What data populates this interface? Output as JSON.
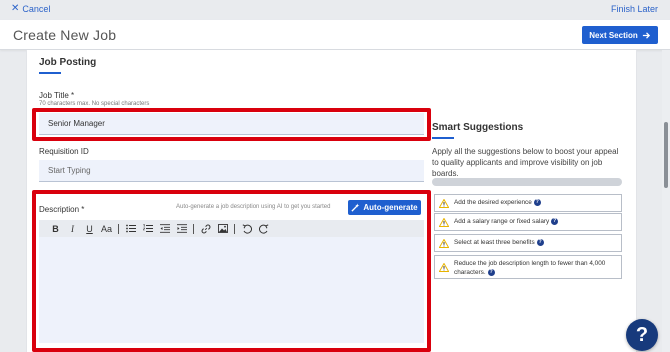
{
  "topbar": {
    "cancel_label": "Cancel",
    "finish_later_label": "Finish Later"
  },
  "header": {
    "title": "Create New Job",
    "next_label": "Next Section"
  },
  "form": {
    "section_title": "Job Posting",
    "job_title": {
      "label": "Job Title *",
      "hint": "70 characters max. No special characters",
      "value": "Senior Manager"
    },
    "requisition": {
      "label": "Requisition ID",
      "placeholder": "Start Typing"
    },
    "description": {
      "label": "Description *",
      "hint": "Auto-generate a job description using AI to get you started",
      "autogen_label": "Auto-generate",
      "value": ""
    }
  },
  "toolbar": {
    "buttons": [
      {
        "name": "bold",
        "glyph": "B"
      },
      {
        "name": "italic",
        "glyph": "I"
      },
      {
        "name": "underline",
        "glyph": "U"
      },
      {
        "name": "font-size",
        "glyph": "Aa"
      },
      {
        "name": "bullet-list",
        "glyph": "≡"
      },
      {
        "name": "numbered-list",
        "glyph": "≡"
      },
      {
        "name": "outdent",
        "glyph": "⇤"
      },
      {
        "name": "indent",
        "glyph": "⇥"
      },
      {
        "name": "link",
        "glyph": "🔗"
      },
      {
        "name": "image",
        "glyph": "▣"
      },
      {
        "name": "undo",
        "glyph": "↶"
      },
      {
        "name": "redo",
        "glyph": "↷"
      }
    ]
  },
  "smart": {
    "title": "Smart Suggestions",
    "description": "Apply all the suggestions below to boost your appeal to quality applicants and improve visibility on job boards.",
    "progress": 0,
    "suggestions": [
      {
        "text": "Add the desired experience"
      },
      {
        "text": "Add a salary range or fixed salary"
      },
      {
        "text": "Select at least three benefits"
      },
      {
        "text": "Reduce the job description length to fewer than 4,000 characters."
      }
    ]
  },
  "icons": {
    "cancel": "close-icon",
    "next": "arrow-right-icon",
    "autogen": "magic-wand-icon",
    "warning": "warning-icon",
    "help": "question-icon"
  },
  "colors": {
    "accent": "#1f5fcf",
    "highlight": "#d9000d",
    "help": "#173a7c",
    "warning": "#e8b400"
  }
}
